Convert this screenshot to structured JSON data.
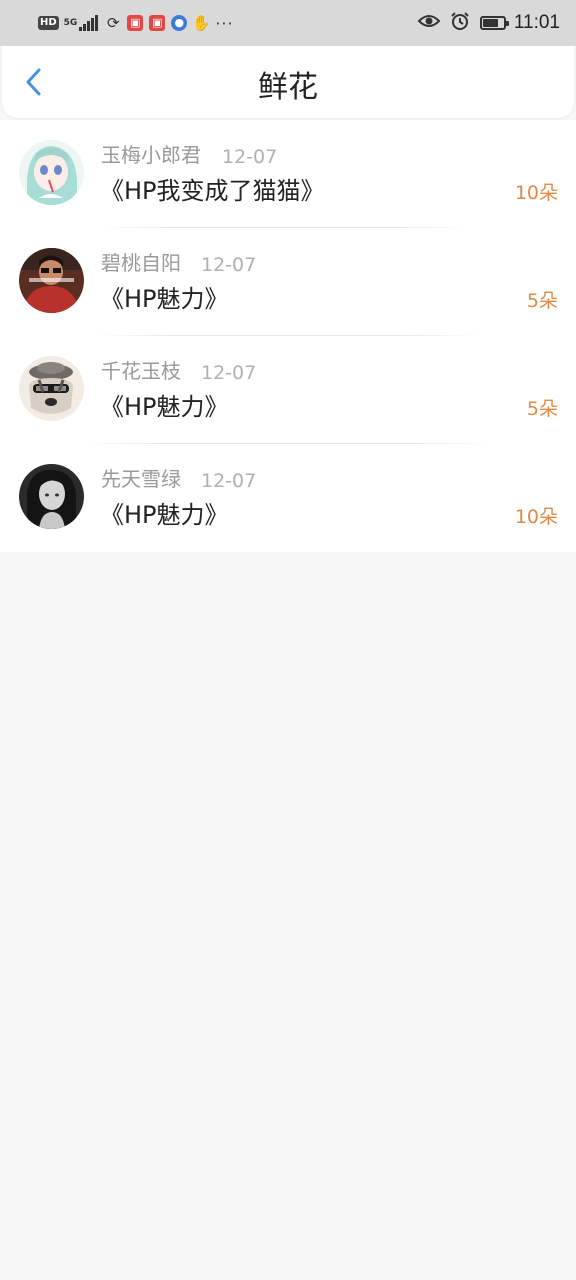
{
  "status_bar": {
    "hd_badge": "HD",
    "network_label": "5G",
    "time": "11:01",
    "battery_level": 0.75,
    "icons": [
      "signal-icon",
      "wifi-icon",
      "app-icon-red",
      "app-icon-red",
      "app-icon-blue",
      "hand-icon",
      "more-icon",
      "eye-icon",
      "alarm-icon",
      "battery-icon"
    ]
  },
  "header": {
    "title": "鲜花",
    "back_icon": "chevron-left-icon",
    "accent_color": "#4a90e2"
  },
  "list": {
    "items": [
      {
        "name": "玉梅小郎君",
        "date": "12-07",
        "book": "《HP我变成了猫猫》",
        "count": "10朵"
      },
      {
        "name": "碧桃自阳",
        "date": "12-07",
        "book": "《HP魅力》",
        "count": "5朵"
      },
      {
        "name": "千花玉枝",
        "date": "12-07",
        "book": "《HP魅力》",
        "count": "5朵"
      },
      {
        "name": "先天雪绿",
        "date": "12-07",
        "book": "《HP魅力》",
        "count": "10朵"
      }
    ],
    "count_color": "#e08a45"
  }
}
